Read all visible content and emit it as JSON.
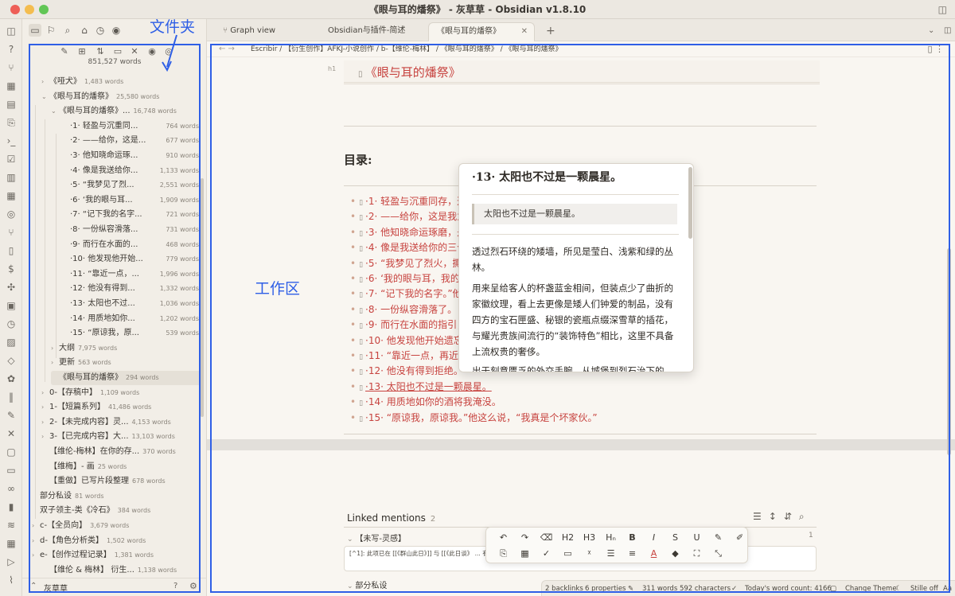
{
  "window": {
    "title": "《眼与耳的燔祭》 - 灰草草 - Obsidian v1.8.10"
  },
  "annotations": {
    "folder": "文件夹",
    "workspace": "工作区"
  },
  "sidebar": {
    "total_words": "851,527 words",
    "vault_name": "灰草草",
    "tree": [
      {
        "label": "《哑犬》",
        "wc": "1,483 words",
        "depth": 2,
        "caret": "›"
      },
      {
        "label": "《眼与耳的燔祭》",
        "wc": "25,580 words",
        "depth": 2,
        "caret": "⌄"
      },
      {
        "label": "《眼与耳的燔祭》...",
        "wc": "16,748 words",
        "depth": 3,
        "caret": "⌄"
      },
      {
        "label": "·1· 轻盈与沉重同...",
        "wc": "764 words",
        "depth": 4,
        "caret": ""
      },
      {
        "label": "·2· ——给你，这是...",
        "wc": "677 words",
        "depth": 4,
        "caret": ""
      },
      {
        "label": "·3· 他知晓命运琢...",
        "wc": "910 words",
        "depth": 4,
        "caret": ""
      },
      {
        "label": "·4· 像是我送给你...",
        "wc": "1,133 words",
        "depth": 4,
        "caret": ""
      },
      {
        "label": "·5· “我梦见了烈...",
        "wc": "2,551 words",
        "depth": 4,
        "caret": ""
      },
      {
        "label": "·6· ‘我的眼与耳...",
        "wc": "1,909 words",
        "depth": 4,
        "caret": ""
      },
      {
        "label": "·7· “记下我的名字...",
        "wc": "721 words",
        "depth": 4,
        "caret": ""
      },
      {
        "label": "·8· 一份纵容滑落...",
        "wc": "731 words",
        "depth": 4,
        "caret": ""
      },
      {
        "label": "·9· 而行在水面的...",
        "wc": "468 words",
        "depth": 4,
        "caret": ""
      },
      {
        "label": "·10· 他发现他开始...",
        "wc": "779 words",
        "depth": 4,
        "caret": ""
      },
      {
        "label": "·11· “靠近一点，...",
        "wc": "1,996 words",
        "depth": 4,
        "caret": ""
      },
      {
        "label": "·12· 他没有得到...",
        "wc": "1,332 words",
        "depth": 4,
        "caret": ""
      },
      {
        "label": "·13· 太阳也不过...",
        "wc": "1,036 words",
        "depth": 4,
        "caret": ""
      },
      {
        "label": "·14· 用质地如你...",
        "wc": "1,202 words",
        "depth": 4,
        "caret": ""
      },
      {
        "label": "·15· “原谅我，原...",
        "wc": "539 words",
        "depth": 4,
        "caret": ""
      },
      {
        "label": "大纲",
        "wc": "7,975 words",
        "depth": 3,
        "caret": "›"
      },
      {
        "label": "更新",
        "wc": "563 words",
        "depth": 3,
        "caret": "›"
      },
      {
        "label": "《眼与耳的燔祭》",
        "wc": "294 words",
        "depth": 3,
        "caret": "",
        "selected": true
      },
      {
        "label": "0-【存稿中】",
        "wc": "1,109 words",
        "depth": 2,
        "caret": "›"
      },
      {
        "label": "1-【短篇系列】",
        "wc": "41,486 words",
        "depth": 2,
        "caret": "›"
      },
      {
        "label": "2-【未完成内容】灵...",
        "wc": "4,153 words",
        "depth": 2,
        "caret": "›"
      },
      {
        "label": "3-【已完成内容】大...",
        "wc": "13,103 words",
        "depth": 2,
        "caret": "›"
      },
      {
        "label": "【维伦-梅林】在你的存...",
        "wc": "370 words",
        "depth": 2,
        "caret": ""
      },
      {
        "label": "【维梅】- 画",
        "wc": "25 words",
        "depth": 2,
        "caret": ""
      },
      {
        "label": "【重做】已写片段整理",
        "wc": "678 words",
        "depth": 2,
        "caret": ""
      },
      {
        "label": "部分私设",
        "wc": "81 words",
        "depth": 1,
        "caret": ""
      },
      {
        "label": "双子领主-类《冷石》",
        "wc": "384 words",
        "depth": 1,
        "caret": ""
      },
      {
        "label": "c-【全员向】",
        "wc": "3,679 words",
        "depth": 1,
        "caret": "›"
      },
      {
        "label": "d-【角色分析类】",
        "wc": "1,502 words",
        "depth": 1,
        "caret": "›"
      },
      {
        "label": "e-【创作过程记录】",
        "wc": "1,381 words",
        "depth": 1,
        "caret": "›"
      },
      {
        "label": "【维伦 & 梅林】 衍生...",
        "wc": "1,138 words",
        "depth": 2,
        "caret": ""
      }
    ]
  },
  "tabs": [
    {
      "label": "Graph view",
      "icon": "graph-icon"
    },
    {
      "label": "Obsidian与插件-简述",
      "icon": ""
    },
    {
      "label": "《眼与耳的燔祭》",
      "icon": "",
      "active": true
    }
  ],
  "breadcrumb": "Escribir / 【衍生创作】AFKJ-小说创作 / b-【维伦-梅林】 / 《眼与耳的燔祭》 / 《眼与耳的燔祭》",
  "document": {
    "h1_tag": "h1",
    "title": "《眼与耳的燔祭》",
    "toc_heading": "目录:",
    "toc": [
      "·1· 轻盈与沉重同存，这",
      "·2· ——给你，这是我为",
      "·3· 他知晓命运琢磨，是",
      "·4· 像是我送给你的三个",
      "·5· “我梦见了烈火，撕",
      "·6· ‘我的眼与耳，我的",
      "·7· “记下我的名字。”他",
      "·8· 一份纵容滑落了。",
      "·9· 而行在水面的指引，",
      "·10· 他发现他开始遗忘",
      "·11· “靠近一点，再近一",
      "·12· 他没有得到拒绝。",
      "·13· 太阳也不过是一颗晨星。",
      "·14· 用质地如你的酒将我淹没。",
      "·15· “原谅我，原谅我。”他这么说，“我真是个坏家伙。”"
    ]
  },
  "popup": {
    "title": "·13· 太阳也不过是一颗晨星。",
    "quote": "太阳也不过是一颗晨星。",
    "p1": "透过烈石环绕的矮墙，所见是莹白、浅紫和绿的丛林。",
    "p2": "用来呈给客人的杯盏蓝金相间，但装点少了曲折的家徽纹理，看上去更像是矮人们钟爱的制品，没有四方的宝石匣盛、秘银的瓷瓶点缀深雪草的插花，与耀光贵族间流行的“装饰特色”相比，这里不具备上流权贵的奢侈。",
    "p3": "出于刻意匮乏的外交手腕，从城堡到烈石治下的"
  },
  "linked_mentions": {
    "title": "Linked mentions",
    "count": "2",
    "group1": "【未写-灵感】",
    "group1_count": "1",
    "snippet": "[^1]: 此项已在 [[《群山此日》]] 与 [[《此日谈》 ... 有人都这么说，”~~ 用在燔祭的第五章。",
    "group2": "部分私设"
  },
  "format_toolbar": {
    "row1": [
      "↶",
      "↷",
      "⌫",
      "H2",
      "H3",
      "Hₙ",
      "B",
      "I",
      "S",
      "U",
      "✎",
      "✐"
    ],
    "row2": [
      "⎘",
      "▦",
      "✓",
      "▭",
      "ᵡ",
      "☰",
      "≡",
      "A",
      "◆",
      "⛶",
      "⤡"
    ]
  },
  "statusbar": {
    "backlinks": "2 backlinks",
    "properties": "6 properties",
    "words": "311 words  592 characters",
    "today": "Today's word count: 4166",
    "theme": "Change Theme",
    "style": "Stille off",
    "aa": "Aa"
  }
}
